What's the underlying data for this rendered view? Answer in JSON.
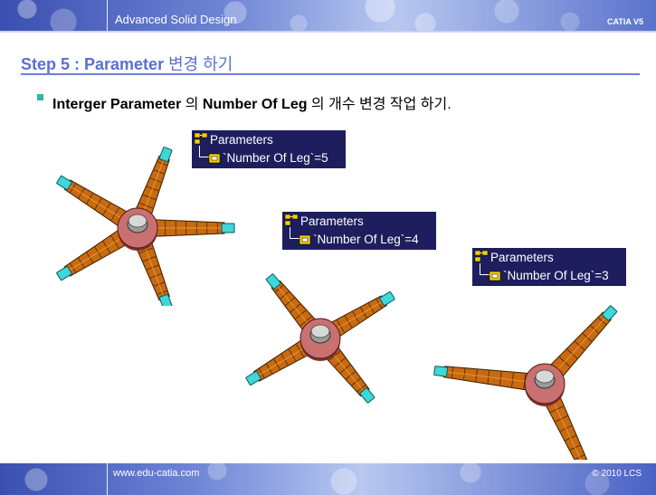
{
  "header": {
    "title": "Advanced Solid Design",
    "brand": "CATIA V5"
  },
  "step": {
    "prefix": "Step 5 : Parameter",
    "suffix": " 변경 하기"
  },
  "bullet": {
    "part1": "Interger Parameter",
    "part2": " 의 ",
    "part3": "Number Of Leg",
    "part4": " 의 개수 변경 작업 하기."
  },
  "params": [
    {
      "title": "Parameters",
      "value": "`Number Of Leg`=5"
    },
    {
      "title": "Parameters",
      "value": "`Number Of Leg`=4"
    },
    {
      "title": "Parameters",
      "value": "`Number Of Leg`=3"
    }
  ],
  "footer": {
    "url": "www.edu-catia.com",
    "copyright": "© 2010 LCS"
  },
  "colors": {
    "accent": "#5b6fcf",
    "param_bg": "#1e1e5e",
    "leg": "#c86a10",
    "foot": "#3fd7d7",
    "hub": "#c97070"
  },
  "chairs": [
    {
      "legs": 5
    },
    {
      "legs": 4
    },
    {
      "legs": 3
    }
  ]
}
